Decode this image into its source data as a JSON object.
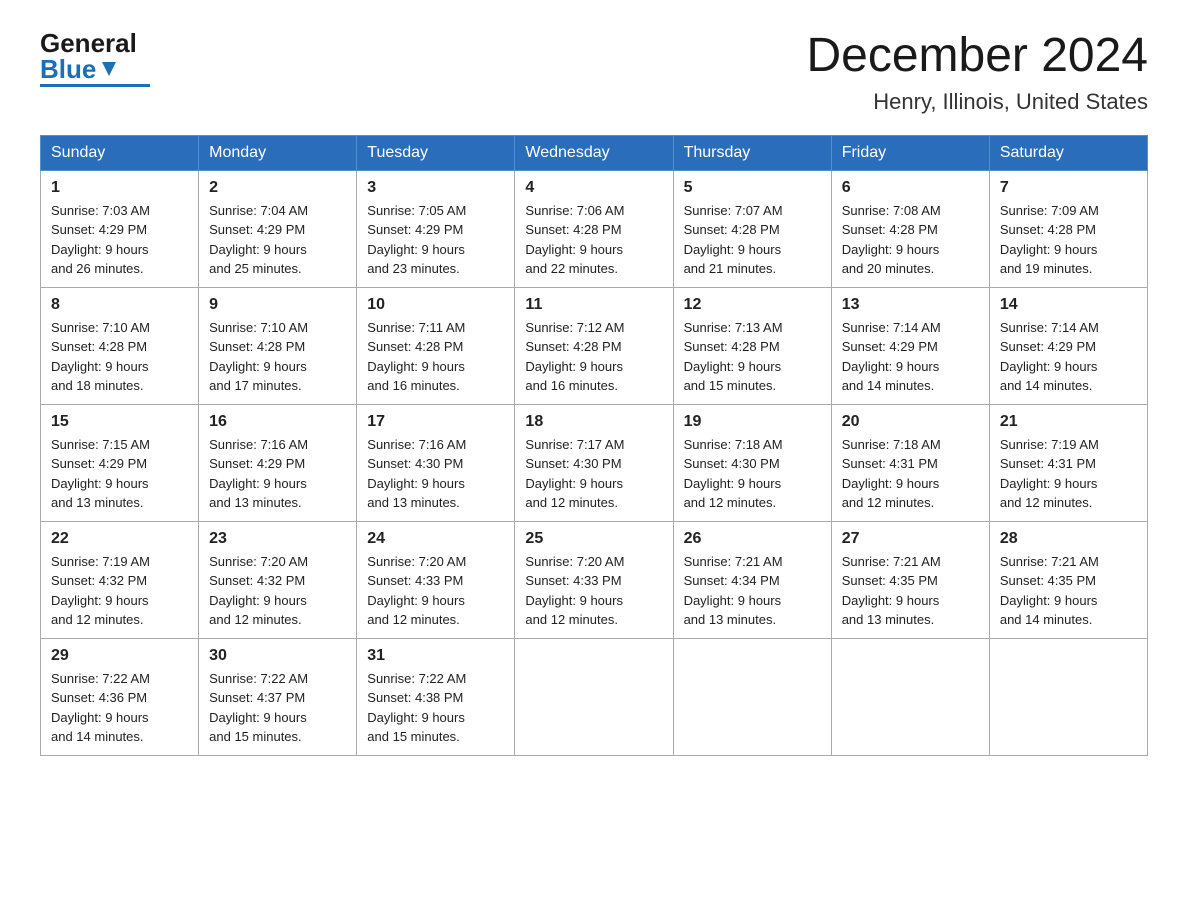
{
  "header": {
    "logo_general": "General",
    "logo_blue": "Blue",
    "title": "December 2024",
    "subtitle": "Henry, Illinois, United States"
  },
  "calendar": {
    "days_of_week": [
      "Sunday",
      "Monday",
      "Tuesday",
      "Wednesday",
      "Thursday",
      "Friday",
      "Saturday"
    ],
    "weeks": [
      [
        {
          "day": "1",
          "sunrise": "7:03 AM",
          "sunset": "4:29 PM",
          "daylight": "9 hours and 26 minutes."
        },
        {
          "day": "2",
          "sunrise": "7:04 AM",
          "sunset": "4:29 PM",
          "daylight": "9 hours and 25 minutes."
        },
        {
          "day": "3",
          "sunrise": "7:05 AM",
          "sunset": "4:29 PM",
          "daylight": "9 hours and 23 minutes."
        },
        {
          "day": "4",
          "sunrise": "7:06 AM",
          "sunset": "4:28 PM",
          "daylight": "9 hours and 22 minutes."
        },
        {
          "day": "5",
          "sunrise": "7:07 AM",
          "sunset": "4:28 PM",
          "daylight": "9 hours and 21 minutes."
        },
        {
          "day": "6",
          "sunrise": "7:08 AM",
          "sunset": "4:28 PM",
          "daylight": "9 hours and 20 minutes."
        },
        {
          "day": "7",
          "sunrise": "7:09 AM",
          "sunset": "4:28 PM",
          "daylight": "9 hours and 19 minutes."
        }
      ],
      [
        {
          "day": "8",
          "sunrise": "7:10 AM",
          "sunset": "4:28 PM",
          "daylight": "9 hours and 18 minutes."
        },
        {
          "day": "9",
          "sunrise": "7:10 AM",
          "sunset": "4:28 PM",
          "daylight": "9 hours and 17 minutes."
        },
        {
          "day": "10",
          "sunrise": "7:11 AM",
          "sunset": "4:28 PM",
          "daylight": "9 hours and 16 minutes."
        },
        {
          "day": "11",
          "sunrise": "7:12 AM",
          "sunset": "4:28 PM",
          "daylight": "9 hours and 16 minutes."
        },
        {
          "day": "12",
          "sunrise": "7:13 AM",
          "sunset": "4:28 PM",
          "daylight": "9 hours and 15 minutes."
        },
        {
          "day": "13",
          "sunrise": "7:14 AM",
          "sunset": "4:29 PM",
          "daylight": "9 hours and 14 minutes."
        },
        {
          "day": "14",
          "sunrise": "7:14 AM",
          "sunset": "4:29 PM",
          "daylight": "9 hours and 14 minutes."
        }
      ],
      [
        {
          "day": "15",
          "sunrise": "7:15 AM",
          "sunset": "4:29 PM",
          "daylight": "9 hours and 13 minutes."
        },
        {
          "day": "16",
          "sunrise": "7:16 AM",
          "sunset": "4:29 PM",
          "daylight": "9 hours and 13 minutes."
        },
        {
          "day": "17",
          "sunrise": "7:16 AM",
          "sunset": "4:30 PM",
          "daylight": "9 hours and 13 minutes."
        },
        {
          "day": "18",
          "sunrise": "7:17 AM",
          "sunset": "4:30 PM",
          "daylight": "9 hours and 12 minutes."
        },
        {
          "day": "19",
          "sunrise": "7:18 AM",
          "sunset": "4:30 PM",
          "daylight": "9 hours and 12 minutes."
        },
        {
          "day": "20",
          "sunrise": "7:18 AM",
          "sunset": "4:31 PM",
          "daylight": "9 hours and 12 minutes."
        },
        {
          "day": "21",
          "sunrise": "7:19 AM",
          "sunset": "4:31 PM",
          "daylight": "9 hours and 12 minutes."
        }
      ],
      [
        {
          "day": "22",
          "sunrise": "7:19 AM",
          "sunset": "4:32 PM",
          "daylight": "9 hours and 12 minutes."
        },
        {
          "day": "23",
          "sunrise": "7:20 AM",
          "sunset": "4:32 PM",
          "daylight": "9 hours and 12 minutes."
        },
        {
          "day": "24",
          "sunrise": "7:20 AM",
          "sunset": "4:33 PM",
          "daylight": "9 hours and 12 minutes."
        },
        {
          "day": "25",
          "sunrise": "7:20 AM",
          "sunset": "4:33 PM",
          "daylight": "9 hours and 12 minutes."
        },
        {
          "day": "26",
          "sunrise": "7:21 AM",
          "sunset": "4:34 PM",
          "daylight": "9 hours and 13 minutes."
        },
        {
          "day": "27",
          "sunrise": "7:21 AM",
          "sunset": "4:35 PM",
          "daylight": "9 hours and 13 minutes."
        },
        {
          "day": "28",
          "sunrise": "7:21 AM",
          "sunset": "4:35 PM",
          "daylight": "9 hours and 14 minutes."
        }
      ],
      [
        {
          "day": "29",
          "sunrise": "7:22 AM",
          "sunset": "4:36 PM",
          "daylight": "9 hours and 14 minutes."
        },
        {
          "day": "30",
          "sunrise": "7:22 AM",
          "sunset": "4:37 PM",
          "daylight": "9 hours and 15 minutes."
        },
        {
          "day": "31",
          "sunrise": "7:22 AM",
          "sunset": "4:38 PM",
          "daylight": "9 hours and 15 minutes."
        },
        null,
        null,
        null,
        null
      ]
    ]
  }
}
